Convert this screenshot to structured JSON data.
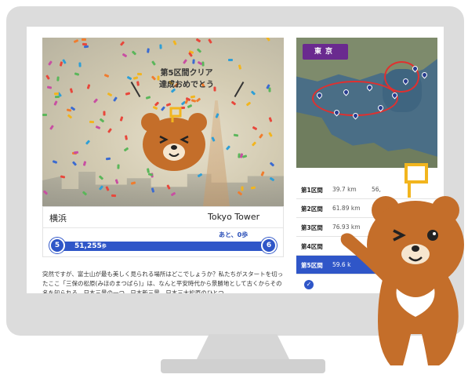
{
  "photo": {
    "congrats_line1": "第5区間クリア",
    "congrats_line2": "達成おめでとう"
  },
  "route": {
    "from": "横浜",
    "to": "Tokyo Tower",
    "remaining": "あと、0歩",
    "start_node": "5",
    "end_node": "6",
    "steps": "51,255",
    "steps_unit": "歩",
    "progress": 1.0
  },
  "article": {
    "text": "突然ですが、富士山が最も美しく見られる場所はどこでしょうか？私たちがスタートを切ったここ「三保の松原(みほのまつばら)」は、なんと平安時代から景勝地として古くからその名を知られる、日本三景の一つ、日本新三景、日本三大松原のひとつ。"
  },
  "map": {
    "label": "東京"
  },
  "sections": [
    {
      "label": "第1区間",
      "distance": "39.7 km",
      "extra": "56,"
    },
    {
      "label": "第2区間",
      "distance": "61.89 km",
      "extra": ""
    },
    {
      "label": "第3区間",
      "distance": "76.93 km",
      "extra": ""
    },
    {
      "label": "第4区間",
      "distance": "",
      "extra": ""
    },
    {
      "label": "第5区間",
      "distance": "59.6 k",
      "extra": ""
    }
  ],
  "colors": {
    "accent": "#2f56c8",
    "bear": "#c46e2a",
    "map_tag": "#6a2a8f",
    "route": "#e0302f"
  },
  "icons": [
    "confetti",
    "bear-mascot",
    "map-pin",
    "check-icon",
    "flag-icon"
  ]
}
